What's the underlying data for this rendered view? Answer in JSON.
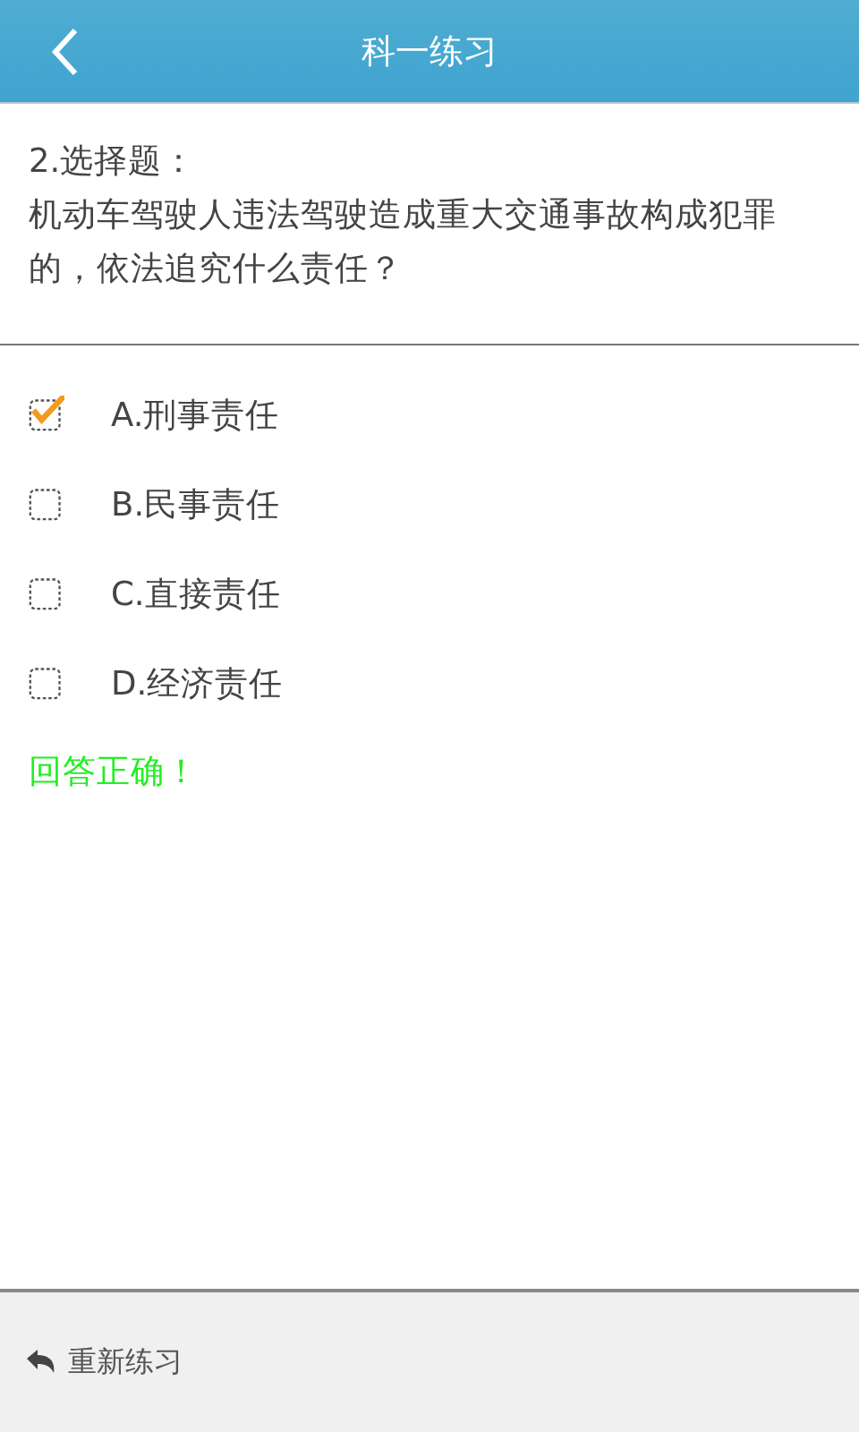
{
  "header": {
    "title": "科一练习"
  },
  "question": {
    "heading": "2.选择题：",
    "text": "机动车驾驶人违法驾驶造成重大交通事故构成犯罪的，依法追究什么责任？"
  },
  "options": [
    {
      "label": "A.刑事责任",
      "checked": true
    },
    {
      "label": "B.民事责任",
      "checked": false
    },
    {
      "label": "C.直接责任",
      "checked": false
    },
    {
      "label": "D.经济责任",
      "checked": false
    }
  ],
  "feedback": "回答正确！",
  "footer": {
    "restart": "重新练习"
  }
}
